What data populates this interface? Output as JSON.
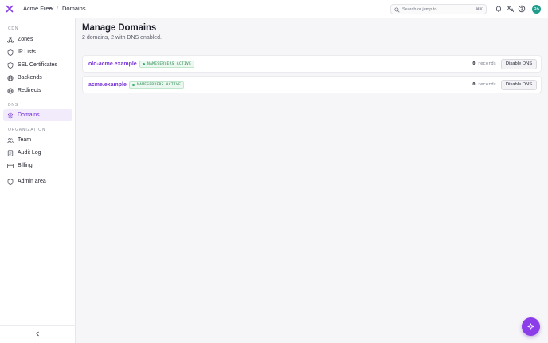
{
  "colors": {
    "accent": "#7a36d8",
    "active_bg": "#f1ebfb",
    "badge_green": "#2d8a55",
    "fab": "#8b3dea",
    "avatar": "#1f9c8b"
  },
  "topbar": {
    "org_name": "Acme Free",
    "breadcrumb_sep": "/",
    "breadcrumb": "Domains",
    "search_placeholder": "Search or jump to...",
    "search_shortcut": "⌘K",
    "avatar_initials": "DA",
    "icons": [
      "bell-icon",
      "translate-icon",
      "help-icon"
    ]
  },
  "sidebar": {
    "sections": [
      {
        "label": "CDN",
        "items": [
          {
            "label": "Zones",
            "icon": "zones-icon"
          },
          {
            "label": "IP Lists",
            "icon": "shield-icon"
          },
          {
            "label": "SSL Certificates",
            "icon": "shield-icon"
          },
          {
            "label": "Backends",
            "icon": "globe-icon"
          },
          {
            "label": "Redirects",
            "icon": "globe-icon"
          }
        ]
      },
      {
        "label": "DNS",
        "items": [
          {
            "label": "Domains",
            "icon": "gear-icon",
            "active": true
          }
        ]
      },
      {
        "label": "ORGANIZATION",
        "items": [
          {
            "label": "Team",
            "icon": "users-icon"
          },
          {
            "label": "Audit Log",
            "icon": "log-icon"
          },
          {
            "label": "Billing",
            "icon": "card-icon"
          }
        ]
      }
    ],
    "admin": {
      "label": "Admin area",
      "icon": "shield-icon"
    }
  },
  "main": {
    "title": "Manage Domains",
    "subtitle": "2 domains, 2 with DNS enabled.",
    "domains": [
      {
        "name": "old-acme.example",
        "status": "NAMESERVERS ACTIVE",
        "records": "0",
        "records_label": "records",
        "action": "Disable DNS"
      },
      {
        "name": "acme.example",
        "status": "NAMESERVERS ACTIVE",
        "records": "0",
        "records_label": "records",
        "action": "Disable DNS"
      }
    ]
  }
}
